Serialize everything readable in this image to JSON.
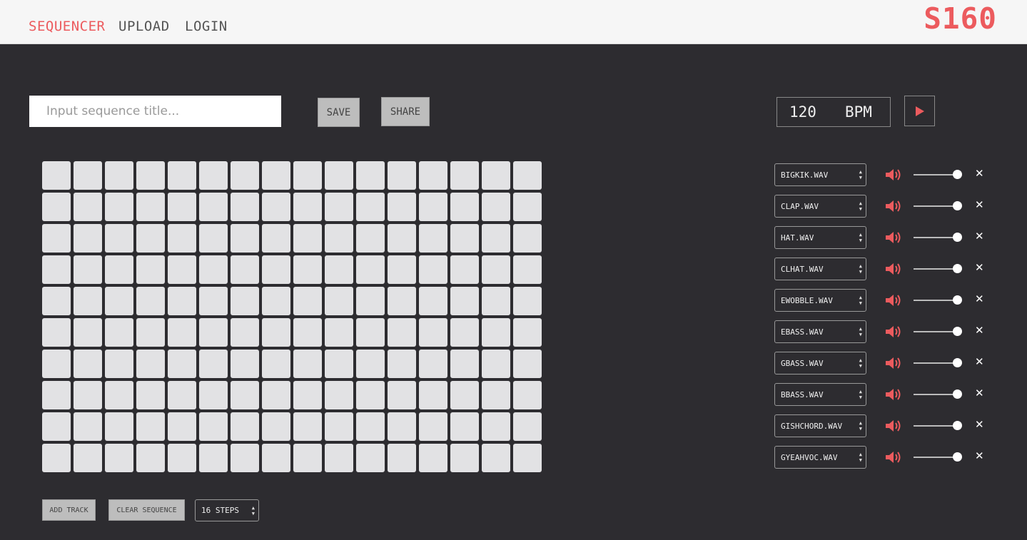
{
  "nav": {
    "links": [
      "SEQUENCER",
      "UPLOAD",
      "LOGIN"
    ],
    "brand": "S160"
  },
  "controls": {
    "title_placeholder": "Input sequence title...",
    "title_value": "",
    "save_label": "SAVE",
    "share_label": "SHARE",
    "bpm_value": "120",
    "bpm_unit": "BPM",
    "play_icon": "play-icon"
  },
  "grid": {
    "rows": 10,
    "columns": 16,
    "active_steps": []
  },
  "tracks": [
    {
      "file": "BIGKIK.WAV"
    },
    {
      "file": "CLAP.WAV"
    },
    {
      "file": "HAT.WAV"
    },
    {
      "file": "CLHAT.WAV"
    },
    {
      "file": "EWOBBLE.WAV"
    },
    {
      "file": "EBASS.WAV"
    },
    {
      "file": "GBASS.WAV"
    },
    {
      "file": "BBASS.WAV"
    },
    {
      "file": "GISHCHORD.WAV"
    },
    {
      "file": "GYEAHVOC.WAV"
    }
  ],
  "track_icons": {
    "volume": "speaker-icon",
    "remove": "close-icon"
  },
  "bottom": {
    "add_track_label": "ADD TRACK",
    "clear_label": "CLEAR SEQUENCE",
    "steps_value": "16 STEPS"
  },
  "colors": {
    "accent": "#ec5b5e",
    "background": "#2d2c30",
    "cell": "#e2e2e4",
    "topbar": "#f6f6f6"
  }
}
